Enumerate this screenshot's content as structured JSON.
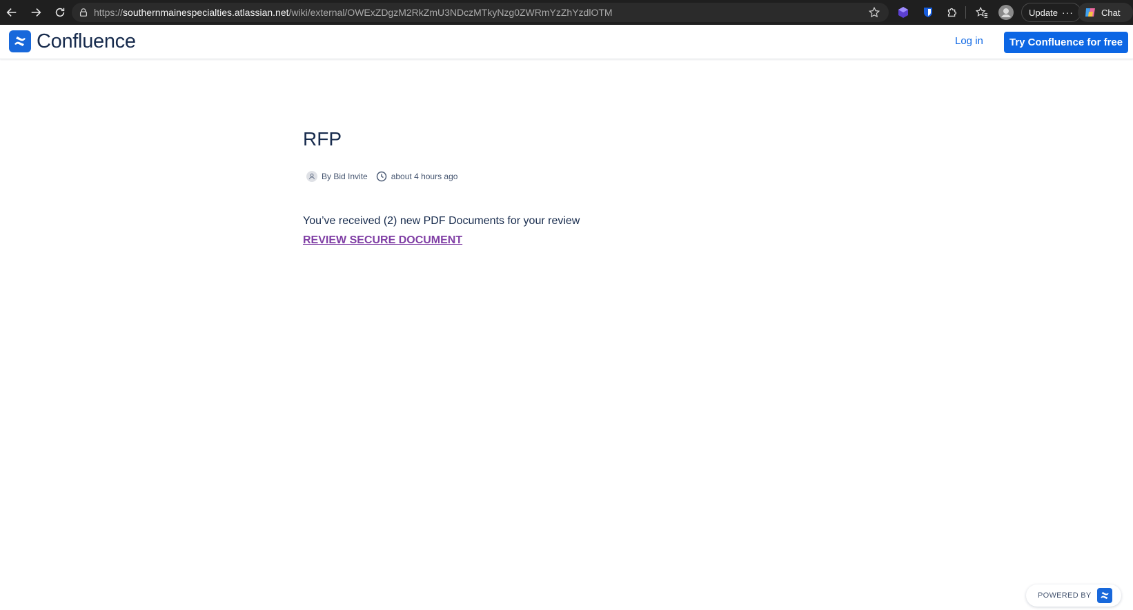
{
  "browser": {
    "url_scheme": "https://",
    "url_host": "southernmainespecialties.atlassian.net",
    "url_path": "/wiki/external/OWExZDgzM2RkZmU3NDczMTkyNzg0ZWRmYzZhYzdlOTM",
    "update_label": "Update",
    "chat_label": "Chat"
  },
  "header": {
    "app_name": "Confluence",
    "login_label": "Log in",
    "try_label": "Try Confluence for free",
    "brand_color": "#1868db"
  },
  "page": {
    "title": "RFP",
    "author": "By Bid Invite",
    "timestamp": "about 4 hours ago",
    "message": "You’ve received (2) new PDF Documents for your review",
    "link_text": "REVIEW SECURE DOCUMENT"
  },
  "footer": {
    "powered_by": "POWERED BY"
  }
}
